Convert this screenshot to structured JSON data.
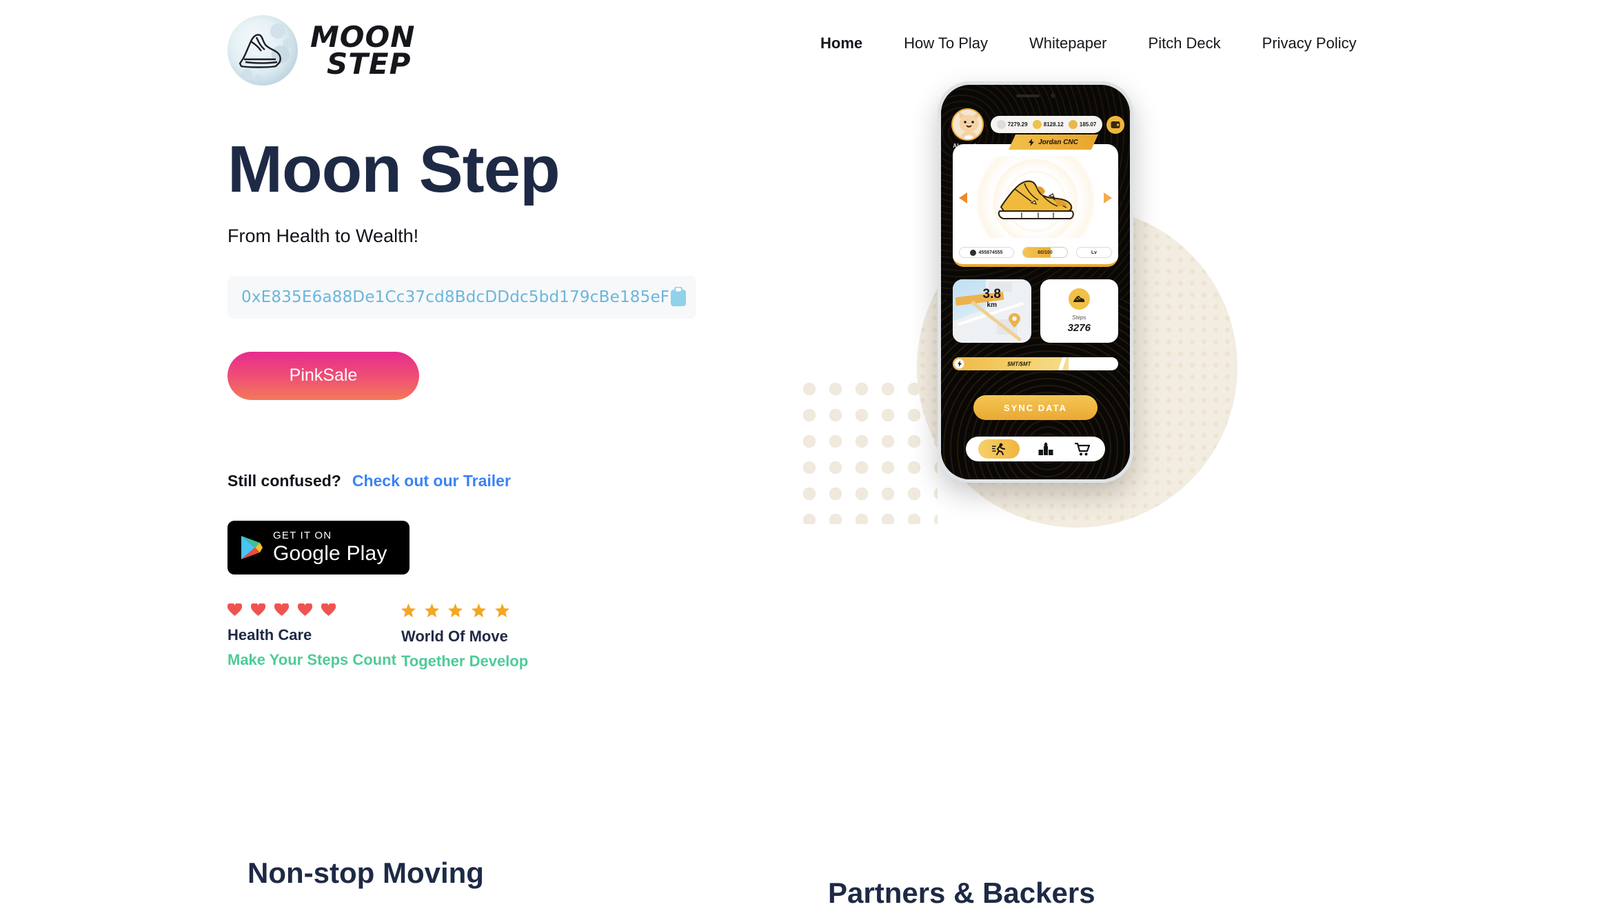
{
  "header": {
    "logo": {
      "line1": "MOON",
      "line2": "STEP",
      "icon": "moon-sneaker-logo"
    },
    "nav": [
      {
        "label": "Home",
        "active": true
      },
      {
        "label": "How To Play",
        "active": false
      },
      {
        "label": "Whitepaper",
        "active": false
      },
      {
        "label": "Pitch Deck",
        "active": false
      },
      {
        "label": "Privacy Policy",
        "active": false
      }
    ]
  },
  "hero": {
    "title": "Moon Step",
    "subtitle": "From Health to Wealth!",
    "contract_address": "0xE835E6a88De1Cc37cd8BdcDDdc5bd179cBe185eF",
    "copy_icon": "clipboard-icon",
    "cta_label": "PinkSale",
    "confused_text": "Still confused?",
    "trailer_link": "Check out our Trailer",
    "store_badge": {
      "small": "GET IT ON",
      "big": "Google Play"
    },
    "features": [
      {
        "icon": "heart-icon",
        "icon_count": 5,
        "title": "Health Care",
        "subtitle": "Make Your Steps Count"
      },
      {
        "icon": "star-icon",
        "icon_count": 5,
        "title": "World Of Move",
        "subtitle": "Together Develop"
      }
    ]
  },
  "phone": {
    "user": {
      "name": "Alexander",
      "avatar": "cat-avatar-icon"
    },
    "stats": [
      {
        "icon": "shoe-token-icon",
        "value": "7279.29"
      },
      {
        "icon": "bolt-token-icon",
        "value": "8128.12"
      },
      {
        "icon": "gem-token-icon",
        "value": "185.07"
      }
    ],
    "wallet_icon": "wallet-icon",
    "shoe_card": {
      "tab_icon": "bolt-icon",
      "tab_label": "Jordan CNC",
      "shoe_image": "sneaker-nft-icon",
      "prev_icon": "arrow-left-icon",
      "next_icon": "arrow-right-icon",
      "id_value": "455874555",
      "durability": "60/100",
      "level_label": "Lv"
    },
    "map_card": {
      "distance": "3.8",
      "unit": "km",
      "pin_icon": "map-pin-icon"
    },
    "steps_card": {
      "icon": "shoe-icon",
      "label": "Steps",
      "value": "3276"
    },
    "energy_bar": {
      "icon": "bolt-icon",
      "label": "$MT/$MT",
      "fill_percent": 70
    },
    "sync_button": "SYNC DATA",
    "tabs": [
      {
        "icon": "running-icon",
        "active": true
      },
      {
        "icon": "podium-icon",
        "active": false
      },
      {
        "icon": "cart-icon",
        "active": false
      }
    ]
  },
  "bottom_headings": {
    "left": "Non-stop Moving",
    "right": "Partners & Backers"
  },
  "colors": {
    "navy": "#1e2a45",
    "link_blue": "#3b82f6",
    "address_blue": "#69b6dd",
    "green": "#4ecb98",
    "heart_red": "#ef5350",
    "star_gold": "#f5a623",
    "gold": "#eaa932",
    "pink_start": "#e62c8e",
    "pink_end": "#f3795a",
    "cream": "#f3ece0"
  }
}
